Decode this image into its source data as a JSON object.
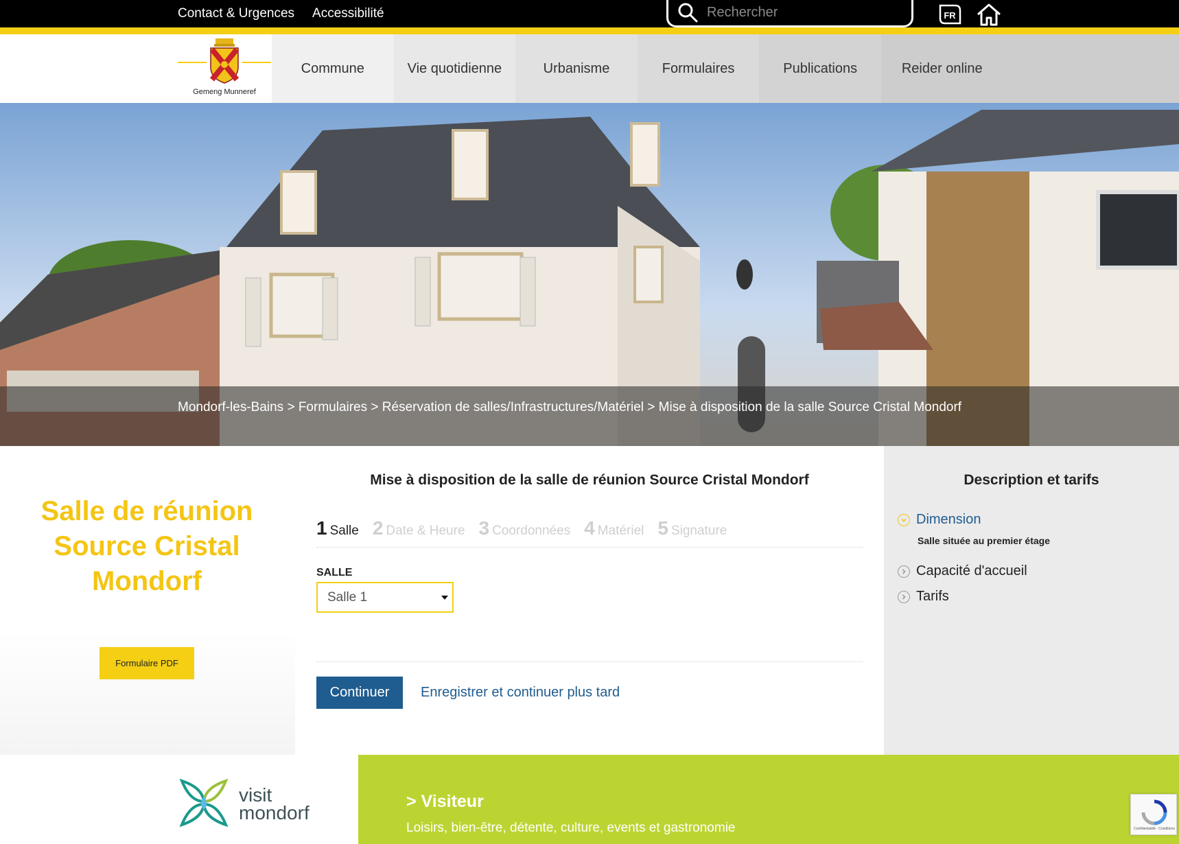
{
  "topbar": {
    "links": [
      "Contact & Urgences",
      "Accessibilité"
    ],
    "search_placeholder": "Rechercher",
    "lang": "FR"
  },
  "logo": {
    "caption": "Gemeng Munneref"
  },
  "nav": {
    "items": [
      "Commune",
      "Vie quotidienne",
      "Urbanisme",
      "Formulaires",
      "Publications",
      "Reider online"
    ]
  },
  "breadcrumb": "Mondorf-les-Bains > Formulaires > Réservation de salles/Infrastructures/Matériel > Mise à disposition de la salle Source Cristal Mondorf",
  "left": {
    "title": "Salle de réunion Source Cristal Mondorf",
    "pdf_button": "Formulaire PDF"
  },
  "form": {
    "title": "Mise à disposition de la salle de réunion Source Cristal Mondorf",
    "steps": [
      {
        "num": "1",
        "label": "Salle"
      },
      {
        "num": "2",
        "label": "Date & Heure"
      },
      {
        "num": "3",
        "label": "Coordonnées"
      },
      {
        "num": "4",
        "label": "Matériel"
      },
      {
        "num": "5",
        "label": "Signature"
      }
    ],
    "field_label": "SALLE",
    "select_value": "Salle 1",
    "continue_button": "Continuer",
    "save_link": "Enregistrer et continuer plus tard"
  },
  "sidebar": {
    "title": "Description et tarifs",
    "items": [
      {
        "label": "Dimension",
        "body": "Salle située au premier étage"
      },
      {
        "label": "Capacité d'accueil"
      },
      {
        "label": "Tarifs"
      }
    ]
  },
  "footer": {
    "logo_text_1": "visit",
    "logo_text_2": "mondorf",
    "heading": "> Visiteur",
    "subtext": "Loisirs, bien-être, détente, culture, events et gastronomie"
  },
  "recaptcha": {
    "text": "Confidentialité - Conditions"
  },
  "colors": {
    "accent_yellow": "#f4cf14",
    "title_yellow": "#f4c514",
    "link_blue": "#1f5c8f",
    "footer_green": "#bcd431"
  }
}
